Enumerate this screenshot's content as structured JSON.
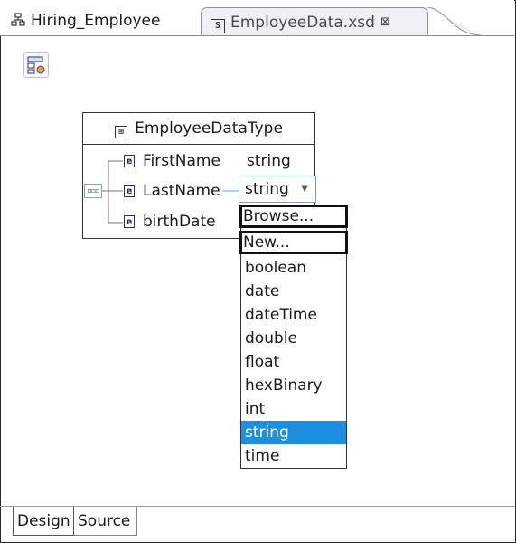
{
  "tabs": [
    {
      "label": "Hiring_Employee",
      "icon": "process-icon",
      "active": false
    },
    {
      "label": "EmployeeData.xsd",
      "icon": "schema-file-icon",
      "active": true,
      "close_glyph": "⊠"
    }
  ],
  "toolbar": {
    "icon": "show-all-types-icon"
  },
  "complex_type": {
    "name": "EmployeeDataType",
    "icon": "complex-type-icon",
    "elements": [
      {
        "name": "FirstName",
        "type": "string",
        "icon": "element-icon"
      },
      {
        "name": "LastName",
        "type": "string",
        "icon": "element-icon",
        "editing": true
      },
      {
        "name": "birthDate",
        "type": "",
        "icon": "element-icon"
      }
    ]
  },
  "type_combo": {
    "value": "string",
    "arrow": "▼"
  },
  "dropdown": {
    "items": [
      "Browse...",
      "New...",
      "boolean",
      "date",
      "dateTime",
      "double",
      "float",
      "hexBinary",
      "int",
      "string",
      "time"
    ],
    "highlighted": [
      "Browse...",
      "New..."
    ],
    "selected": "string"
  },
  "bottom_tabs": [
    {
      "label": "Design",
      "active": true
    },
    {
      "label": "Source",
      "active": false
    }
  ],
  "colors": {
    "selection": "#1e8fe0",
    "combo_border": "#6aa2d8"
  }
}
